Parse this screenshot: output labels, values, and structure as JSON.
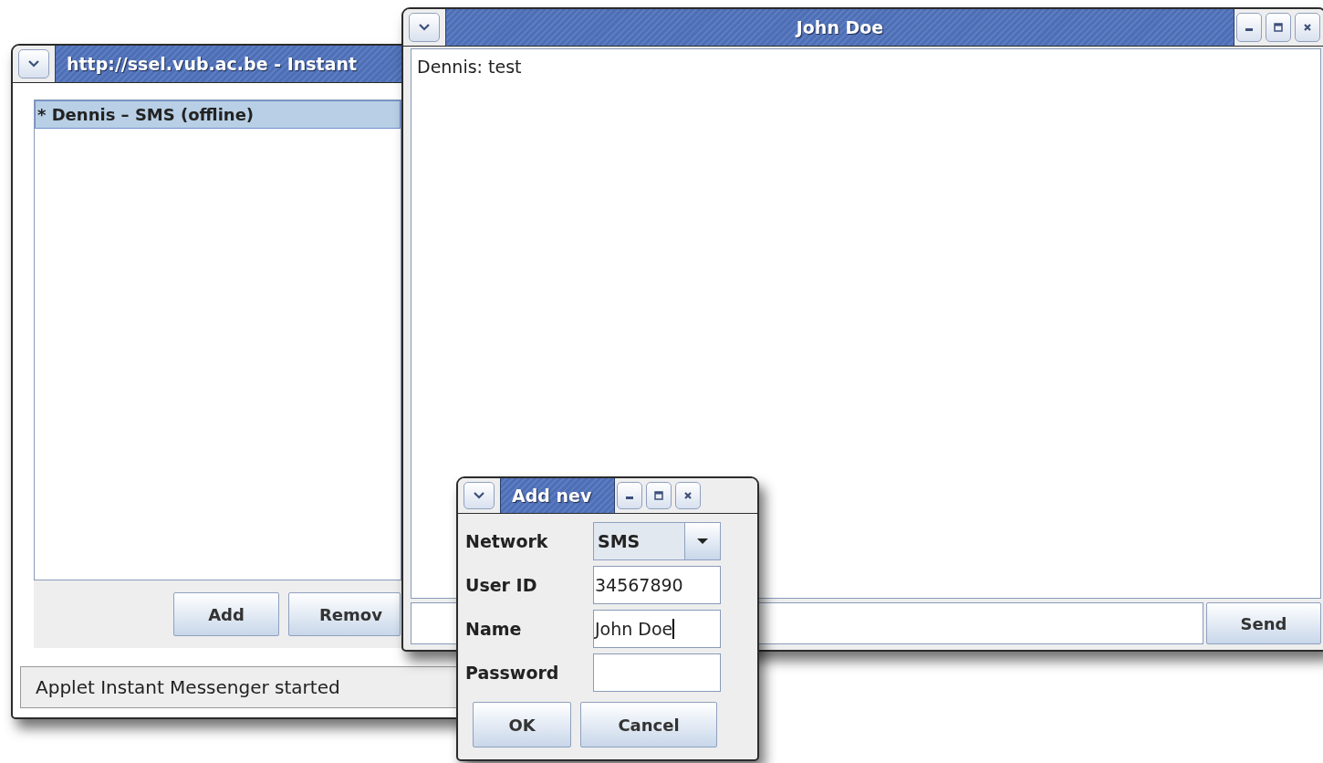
{
  "main_window": {
    "title": "http://ssel.vub.ac.be - Instant",
    "contacts": [
      {
        "label": "* Dennis – SMS (offline)",
        "selected": true
      }
    ],
    "buttons": [
      "Add",
      "Remov"
    ],
    "status_bar": "Applet Instant Messenger started"
  },
  "chat_window": {
    "title": "John Doe",
    "messages": [
      "Dennis: test"
    ],
    "send_button": "Send"
  },
  "dialog": {
    "title": "Add nev",
    "fields": [
      {
        "label": "Network",
        "kind": "dropdown",
        "value": "SMS"
      },
      {
        "label": "User ID",
        "kind": "text",
        "value": "34567890"
      },
      {
        "label": "Name",
        "kind": "text",
        "value": "John Doe",
        "focused": true
      },
      {
        "label": "Password",
        "kind": "password"
      }
    ],
    "buttons": [
      "OK",
      "Cancel"
    ]
  }
}
